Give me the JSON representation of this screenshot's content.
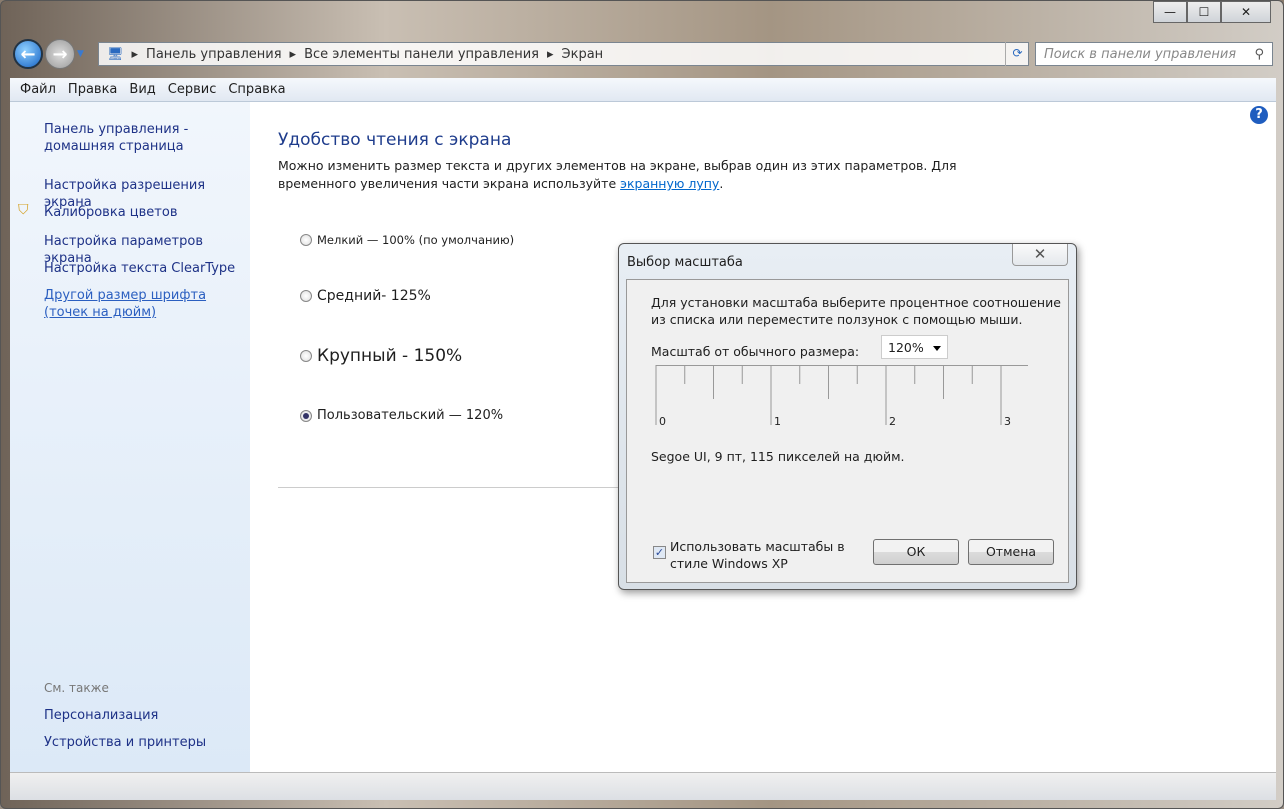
{
  "window": {
    "minimize": "—",
    "maximize": "☐",
    "close": "✕"
  },
  "breadcrumb": [
    "Панель управления",
    "Все элементы панели управления",
    "Экран"
  ],
  "search": {
    "placeholder": "Поиск в панели управления"
  },
  "menu": [
    "Файл",
    "Правка",
    "Вид",
    "Сервис",
    "Справка"
  ],
  "sidebar": {
    "home": "Панель управления - домашняя страница",
    "items": [
      "Настройка разрешения экрана",
      "Калибровка цветов",
      "Настройка параметров экрана",
      "Настройка текста ClearType",
      "Другой размер шрифта (точек на дюйм)"
    ],
    "see_also": "См. также",
    "links": [
      "Персонализация",
      "Устройства и принтеры"
    ]
  },
  "main": {
    "title": "Удобство чтения с экрана",
    "desc": "Можно изменить размер текста и других элементов на экране, выбрав один из этих параметров. Для временного увеличения части экрана используйте ",
    "link": "экранную лупу",
    "desc_end": ".",
    "options": [
      "Мелкий — 100% (по умолчанию)",
      "Средний- 125%",
      "Крупный - 150%",
      "Пользовательский — 120%"
    ],
    "selected": 3
  },
  "dialog": {
    "title": "Выбор масштаба",
    "close": "✕",
    "instr1": "Для установки масштаба выберите процентное соотношение",
    "instr2": "из списка или переместите ползунок с помощью мыши.",
    "scale_label": "Масштаб от обычного размера:",
    "scale_value": "120%",
    "ruler_labels": [
      "0",
      "1",
      "2",
      "3"
    ],
    "font_info": "Segoe UI, 9 пт, 115 пикселей на дюйм.",
    "xp_line1": "Использовать масштабы в",
    "xp_line2": "стиле Windows XP",
    "xp_checked": true,
    "ok": "ОК",
    "cancel": "Отмена"
  }
}
